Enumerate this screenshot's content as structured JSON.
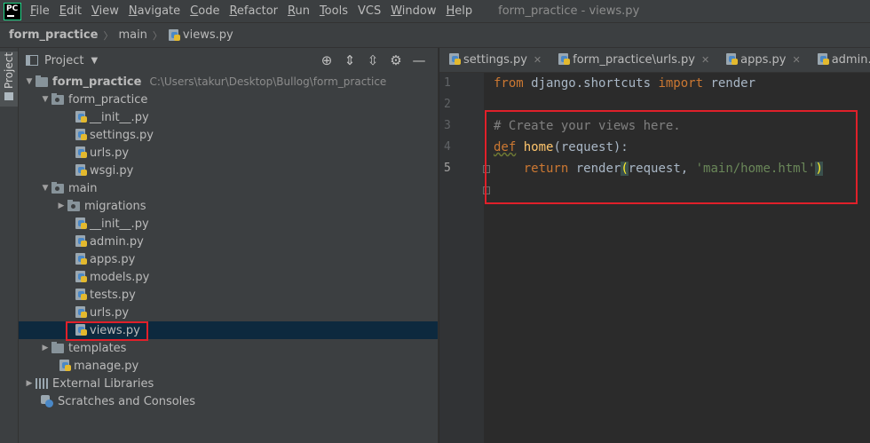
{
  "app": {
    "logo_text": "PC",
    "window_title": "form_practice - views.py"
  },
  "menu": [
    {
      "mnemonic": "F",
      "rest": "ile"
    },
    {
      "mnemonic": "E",
      "rest": "dit"
    },
    {
      "mnemonic": "V",
      "rest": "iew"
    },
    {
      "mnemonic": "N",
      "rest": "avigate"
    },
    {
      "mnemonic": "C",
      "rest": "ode"
    },
    {
      "mnemonic": "R",
      "rest": "efactor"
    },
    {
      "mnemonic": "R",
      "rest": "un"
    },
    {
      "mnemonic": "T",
      "rest": "ools"
    },
    {
      "mnemonic": "",
      "rest": "VCS"
    },
    {
      "mnemonic": "W",
      "rest": "indow"
    },
    {
      "mnemonic": "H",
      "rest": "elp"
    }
  ],
  "breadcrumb": {
    "project": "form_practice",
    "folder": "main",
    "file": "views.py"
  },
  "toolstrip": {
    "project_tab": "Project"
  },
  "project_panel": {
    "title": "Project",
    "tool_icons": [
      "locate-icon",
      "expand-all-icon",
      "collapse-all-icon",
      "gear-icon",
      "minimize-icon"
    ],
    "tree": {
      "root": {
        "name": "form_practice",
        "path": "C:\\Users\\takur\\Desktop\\Bullog\\form_practice"
      },
      "pkg1": "form_practice",
      "pkg1_files": [
        "__init__.py",
        "settings.py",
        "urls.py",
        "wsgi.py"
      ],
      "pkg2": "main",
      "migrations": "migrations",
      "pkg2_files": [
        "__init__.py",
        "admin.py",
        "apps.py",
        "models.py",
        "tests.py",
        "urls.py",
        "views.py"
      ],
      "templates": "templates",
      "manage": "manage.py",
      "external": "External Libraries",
      "scratches": "Scratches and Consoles"
    }
  },
  "editor": {
    "tabs": [
      "settings.py",
      "form_practice\\urls.py",
      "apps.py",
      "admin.py"
    ],
    "line_numbers": [
      "1",
      "2",
      "3",
      "4",
      "5"
    ],
    "code": {
      "l1_kw1": "from",
      "l1_mod": " django.shortcuts ",
      "l1_kw2": "import",
      "l1_name": " render",
      "l3_comment": "# Create your views here.",
      "l4_kw": "def",
      "l4_fn": "home",
      "l4_rest": "(request):",
      "l5_indent": "    ",
      "l5_kw": "return",
      "l5_call": " render",
      "l5_open": "(",
      "l5_args": "request, ",
      "l5_str": "'main/home.html'",
      "l5_close": ")"
    }
  },
  "colors": {
    "annotation_box": "#e0202a",
    "selection": "#0d293e",
    "keyword": "#cc7832",
    "string": "#6a8759",
    "function": "#ffc66d",
    "comment": "#808080"
  }
}
